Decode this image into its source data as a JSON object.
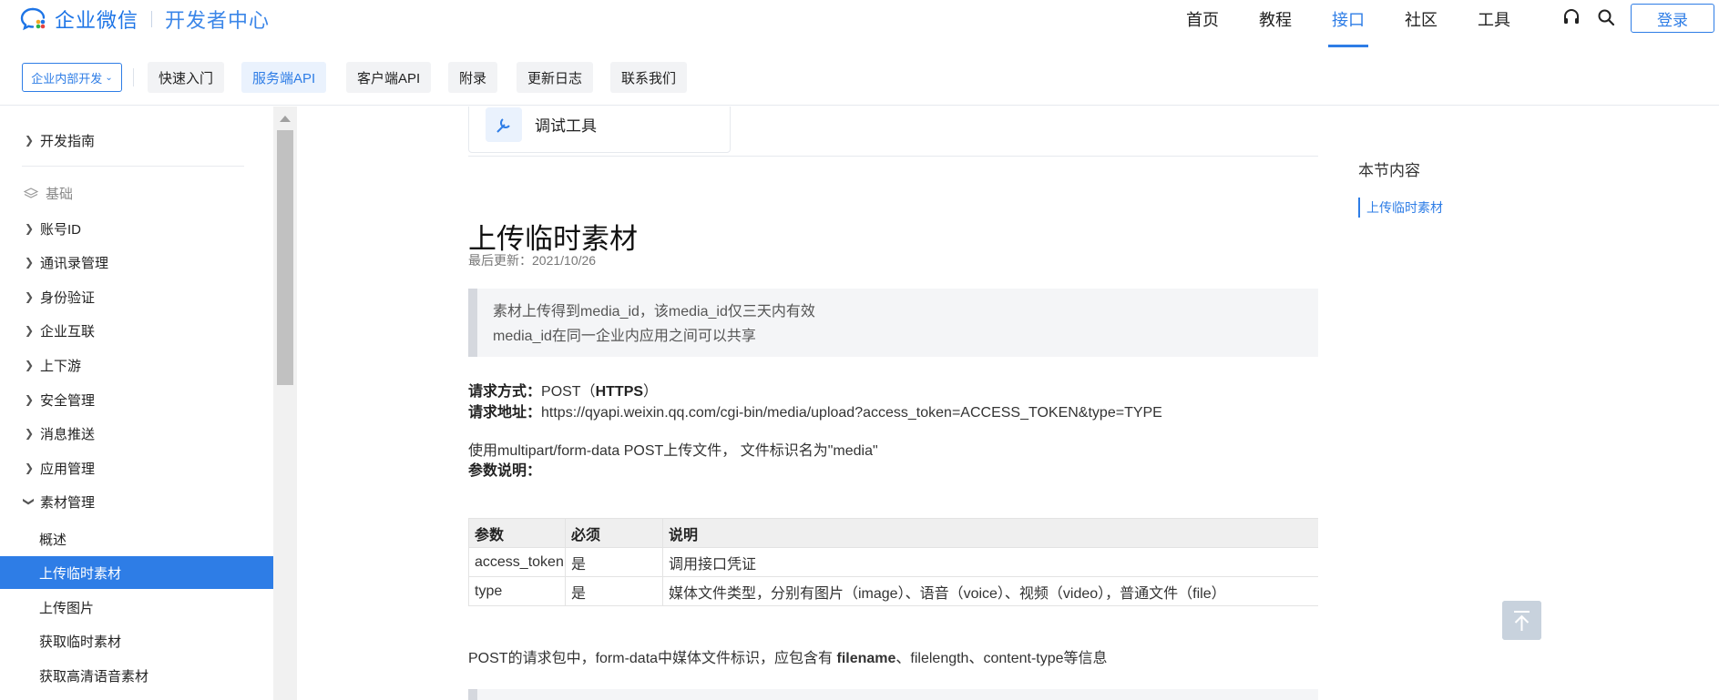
{
  "header": {
    "brand_name": "企业微信",
    "brand_sub": "开发者中心",
    "nav": [
      "首页",
      "教程",
      "接口",
      "社区",
      "工具"
    ],
    "active_nav": "接口",
    "login_label": "登录",
    "icons": [
      "headset-icon",
      "search-icon"
    ]
  },
  "subnav": {
    "scope_label": "企业内部开发",
    "tabs": [
      "快速入门",
      "服务端API",
      "客户端API",
      "附录",
      "更新日志",
      "联系我们"
    ],
    "active_tab": "服务端API"
  },
  "sidebar": {
    "top_item": "开发指南",
    "group_label": "基础",
    "items": [
      "账号ID",
      "通讯录管理",
      "身份验证",
      "企业互联",
      "上下游",
      "安全管理",
      "消息推送",
      "应用管理",
      "素材管理"
    ],
    "sub_items": [
      "概述",
      "上传临时素材",
      "上传图片",
      "获取临时素材",
      "获取高清语音素材"
    ],
    "active_sub": "上传临时素材"
  },
  "content": {
    "tool_label": "调试工具",
    "title": "上传临时素材",
    "updated": "最后更新：2021/10/26",
    "note_lines": [
      "素材上传得到media_id，该media_id仅三天内有效",
      "media_id在同一企业内应用之间可以共享"
    ],
    "method_label": "请求方式：",
    "method_value_prefix": "POST（",
    "method_value_bold": "HTTPS",
    "method_value_suffix": "）",
    "url_label": "请求地址：",
    "url_value": "https://qyapi.weixin.qq.com/cgi-bin/media/upload?access_token=ACCESS_TOKEN&type=TYPE",
    "upload_desc": "使用multipart/form-data POST上传文件， 文件标识名为\"media\"",
    "params_label": "参数说明：",
    "table": {
      "headers": [
        "参数",
        "必须",
        "说明"
      ],
      "rows": [
        [
          "access_token",
          "是",
          "调用接口凭证"
        ],
        [
          "type",
          "是",
          "媒体文件类型，分别有图片（image）、语音（voice）、视频（video），普通文件（file）"
        ]
      ]
    },
    "post_desc_prefix": "POST的请求包中，form-data中媒体文件标识，应包含有 ",
    "post_desc_bold": "filename",
    "post_desc_suffix": "、filelength、content-type等信息"
  },
  "toc": {
    "title": "本节内容",
    "items": [
      "上传临时素材"
    ]
  },
  "colors": {
    "accent": "#2e7de6",
    "brand": "#1d74e6",
    "sidebar_active_bg": "#2e7de6",
    "note_bg": "#f4f5f7"
  }
}
